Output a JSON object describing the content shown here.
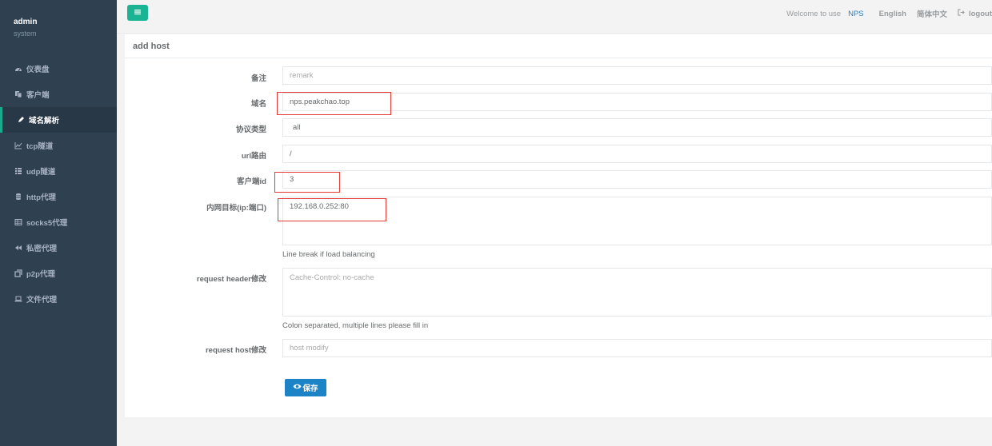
{
  "profile": {
    "name": "admin",
    "role": "system"
  },
  "nav": [
    {
      "label": "仪表盘",
      "icon": "dashboard-icon"
    },
    {
      "label": "客户端",
      "icon": "copy-icon"
    },
    {
      "label": "域名解析",
      "icon": "pencil-icon",
      "active": true
    },
    {
      "label": "tcp隧道",
      "icon": "line-chart-icon"
    },
    {
      "label": "udp隧道",
      "icon": "list-icon"
    },
    {
      "label": "http代理",
      "icon": "database-icon"
    },
    {
      "label": "socks5代理",
      "icon": "table-icon"
    },
    {
      "label": "私密代理",
      "icon": "backward-icon"
    },
    {
      "label": "p2p代理",
      "icon": "clone-icon"
    },
    {
      "label": "文件代理",
      "icon": "laptop-icon"
    }
  ],
  "topbar": {
    "welcome": "Welcome to use",
    "brand": "NPS",
    "english": "English",
    "chinese": "简体中文",
    "logout": "logout"
  },
  "form": {
    "title": "add host",
    "remark": {
      "label": "备注",
      "placeholder": "remark"
    },
    "domain": {
      "label": "域名",
      "value": "nps.peakchao.top"
    },
    "protocol": {
      "label": "协议类型",
      "value": "all"
    },
    "url_route": {
      "label": "url路由",
      "value": "/"
    },
    "client_id": {
      "label": "客户端id",
      "value": "3"
    },
    "target": {
      "label": "内网目标(ip:端口)",
      "value": "192.168.0.252:80",
      "help": "Line break if load balancing"
    },
    "header": {
      "label": "request header修改",
      "placeholder": "Cache-Control: no-cache",
      "help": "Colon separated, multiple lines please fill in"
    },
    "host_modify": {
      "label": "request host修改",
      "placeholder": "host modify"
    },
    "save_label": "保存"
  },
  "accent_colors": {
    "sidebar": "#2f4050",
    "menu_button": "#1ab394",
    "save_button": "#1c84c6",
    "highlight_box": "#e53935"
  }
}
